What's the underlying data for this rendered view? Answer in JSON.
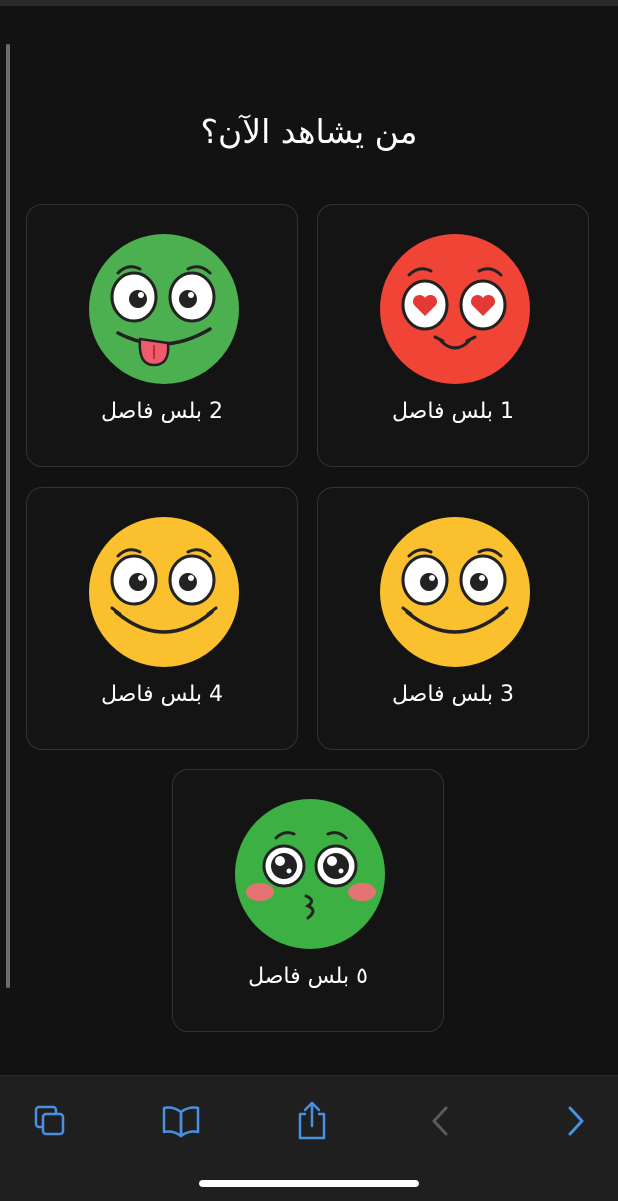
{
  "page": {
    "title": "من يشاهد الآن؟"
  },
  "profiles": [
    {
      "label": "1 بلس فاصل",
      "face": "heart-eyes-face-icon",
      "color": "#F04436"
    },
    {
      "label": "2 بلس فاصل",
      "face": "tongue-out-face-icon",
      "color": "#4CAF50"
    },
    {
      "label": "3 بلس فاصل",
      "face": "smiling-face-icon",
      "color": "#FBC02D"
    },
    {
      "label": "4 بلس فاصل",
      "face": "smiling-face-icon",
      "color": "#FBC02D"
    },
    {
      "label": "٥ بلس فاصل",
      "face": "kissing-blush-face-icon",
      "color": "#3DB043"
    }
  ],
  "toolbar": {
    "icons": [
      "tabs-icon",
      "bookmarks-icon",
      "share-icon",
      "back-icon",
      "forward-icon"
    ],
    "accent": "#4A90E2",
    "disabled": "#5a5a5a"
  }
}
